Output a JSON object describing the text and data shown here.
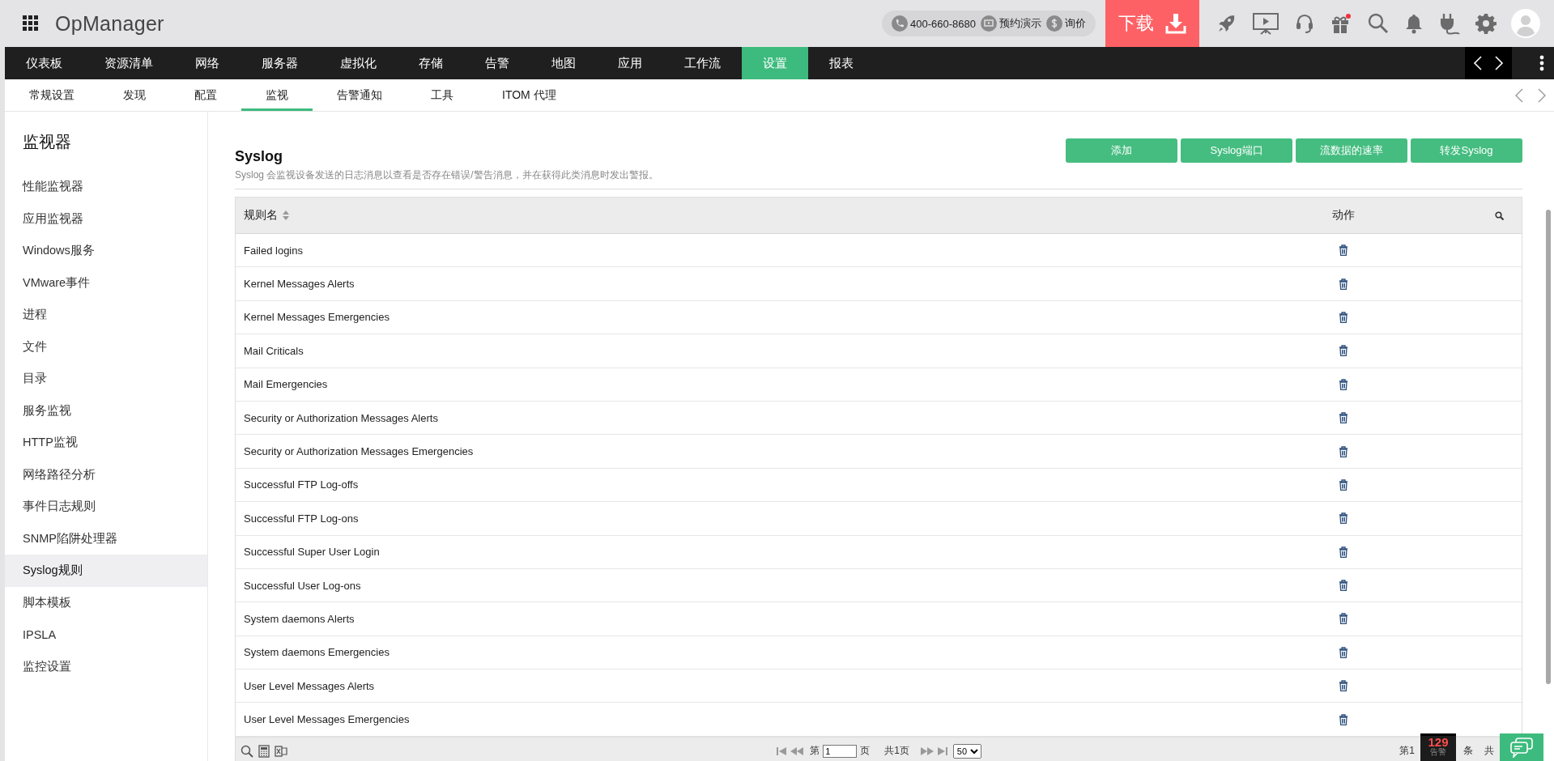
{
  "app": {
    "name": "OpManager"
  },
  "contact": [
    {
      "kind": "phone",
      "label": "400-660-8680"
    },
    {
      "kind": "demo",
      "label": "预约演示"
    },
    {
      "kind": "price",
      "label": "询价"
    }
  ],
  "download_button": "下载",
  "main_nav": [
    {
      "label": "仪表板",
      "selected": false
    },
    {
      "label": "资源清单",
      "selected": false
    },
    {
      "label": "网络",
      "selected": false
    },
    {
      "label": "服务器",
      "selected": false
    },
    {
      "label": "虚拟化",
      "selected": false
    },
    {
      "label": "存储",
      "selected": false
    },
    {
      "label": "告警",
      "selected": false
    },
    {
      "label": "地图",
      "selected": false
    },
    {
      "label": "应用",
      "selected": false
    },
    {
      "label": "工作流",
      "selected": false
    },
    {
      "label": "设置",
      "selected": true
    },
    {
      "label": "报表",
      "selected": false
    }
  ],
  "sub_nav": [
    {
      "label": "常规设置",
      "selected": false
    },
    {
      "label": "发现",
      "selected": false
    },
    {
      "label": "配置",
      "selected": false
    },
    {
      "label": "监视",
      "selected": true
    },
    {
      "label": "告警通知",
      "selected": false
    },
    {
      "label": "工具",
      "selected": false
    },
    {
      "label": "ITOM 代理",
      "selected": false
    }
  ],
  "sidebar": {
    "title": "监视器",
    "items": [
      {
        "label": "性能监视器",
        "selected": false
      },
      {
        "label": "应用监视器",
        "selected": false
      },
      {
        "label": "Windows服务",
        "selected": false
      },
      {
        "label": "VMware事件",
        "selected": false
      },
      {
        "label": "进程",
        "selected": false
      },
      {
        "label": "文件",
        "selected": false
      },
      {
        "label": "目录",
        "selected": false
      },
      {
        "label": "服务监视",
        "selected": false
      },
      {
        "label": "HTTP监视",
        "selected": false
      },
      {
        "label": "网络路径分析",
        "selected": false
      },
      {
        "label": "事件日志规则",
        "selected": false
      },
      {
        "label": "SNMP陷阱处理器",
        "selected": false
      },
      {
        "label": "Syslog规则",
        "selected": true
      },
      {
        "label": "脚本模板",
        "selected": false
      },
      {
        "label": "IPSLA",
        "selected": false
      },
      {
        "label": "监控设置",
        "selected": false
      }
    ]
  },
  "page": {
    "title": "Syslog",
    "description": "Syslog 会监视设备发送的日志消息以查看是否存在错误/警告消息，并在获得此类消息时发出警报。",
    "buttons": [
      "添加",
      "Syslog端口",
      "流数据的速率",
      "转发Syslog"
    ]
  },
  "table": {
    "columns": [
      "规则名",
      "动作"
    ],
    "rows": [
      {
        "name": "Failed logins"
      },
      {
        "name": "Kernel Messages Alerts"
      },
      {
        "name": "Kernel Messages Emergencies"
      },
      {
        "name": "Mail Criticals"
      },
      {
        "name": "Mail Emergencies"
      },
      {
        "name": "Security or Authorization Messages Alerts"
      },
      {
        "name": "Security or Authorization Messages Emergencies"
      },
      {
        "name": "Successful FTP Log-offs"
      },
      {
        "name": "Successful FTP Log-ons"
      },
      {
        "name": "Successful Super User Login"
      },
      {
        "name": "Successful User Log-ons"
      },
      {
        "name": "System daemons Alerts"
      },
      {
        "name": "System daemons Emergencies"
      },
      {
        "name": "User Level Messages Alerts"
      },
      {
        "name": "User Level Messages Emergencies"
      }
    ]
  },
  "pagination": {
    "page_prefix": "第",
    "page_value": "1",
    "page_suffix": "页",
    "total_pages": "共1页",
    "page_size": "50",
    "range_start": "第1",
    "range_unit": "条",
    "total_prefix": "共"
  },
  "alert_badge": {
    "count": "129",
    "label": "告警"
  }
}
